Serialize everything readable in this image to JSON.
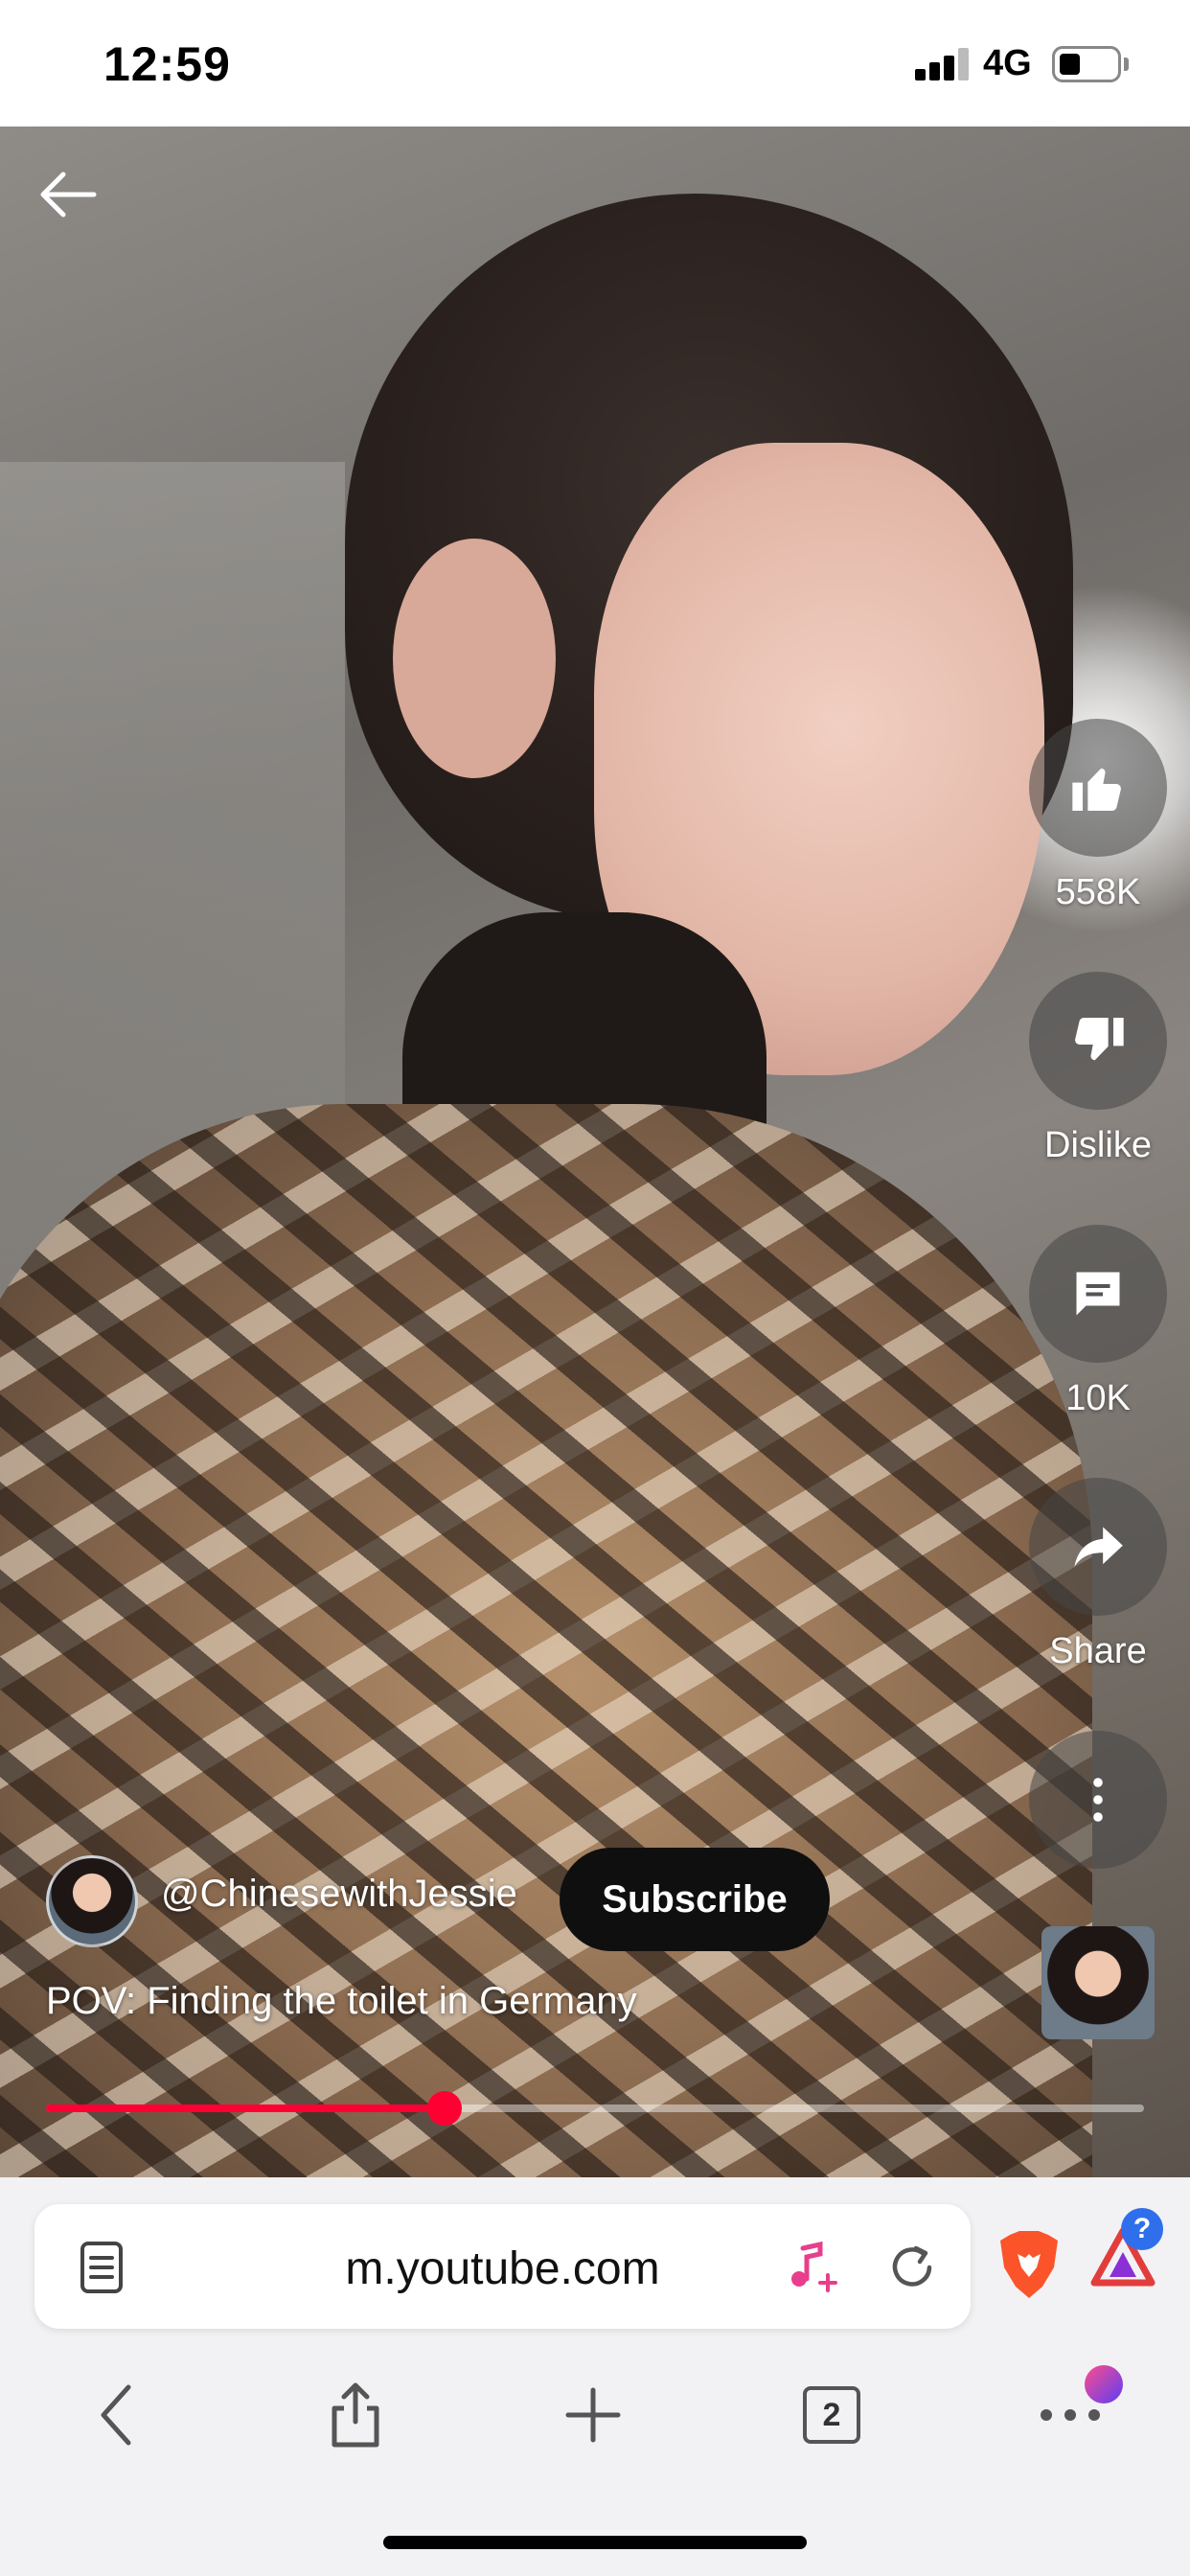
{
  "status_bar": {
    "time": "12:59",
    "network": "4G",
    "battery_level": 0.35
  },
  "video": {
    "back_icon": "back-arrow-icon",
    "actions": [
      {
        "id": "like",
        "icon": "thumbs-up-icon",
        "label": "558K"
      },
      {
        "id": "dislike",
        "icon": "thumbs-down-icon",
        "label": "Dislike"
      },
      {
        "id": "comments",
        "icon": "comment-icon",
        "label": "10K"
      },
      {
        "id": "share",
        "icon": "share-icon",
        "label": "Share"
      },
      {
        "id": "more",
        "icon": "more-vertical-icon",
        "label": ""
      }
    ],
    "channel_name": "@ChinesewithJessie",
    "subscribe_label": "Subscribe",
    "title": "POV: Finding the toilet in Germany",
    "progress": 0.363,
    "progress_color": "#ff0033"
  },
  "browser": {
    "url": "m.youtube.com",
    "tab_count": "2",
    "rewards_badge": "?",
    "icons": {
      "reader": "reader-mode-icon",
      "music": "music-note-add-icon",
      "reload": "reload-icon",
      "brave": "brave-lion-icon",
      "rewards": "brave-rewards-icon"
    },
    "toolbar": [
      "back-icon",
      "share-icon",
      "new-tab-icon",
      "tabs-icon",
      "menu-icon"
    ]
  }
}
